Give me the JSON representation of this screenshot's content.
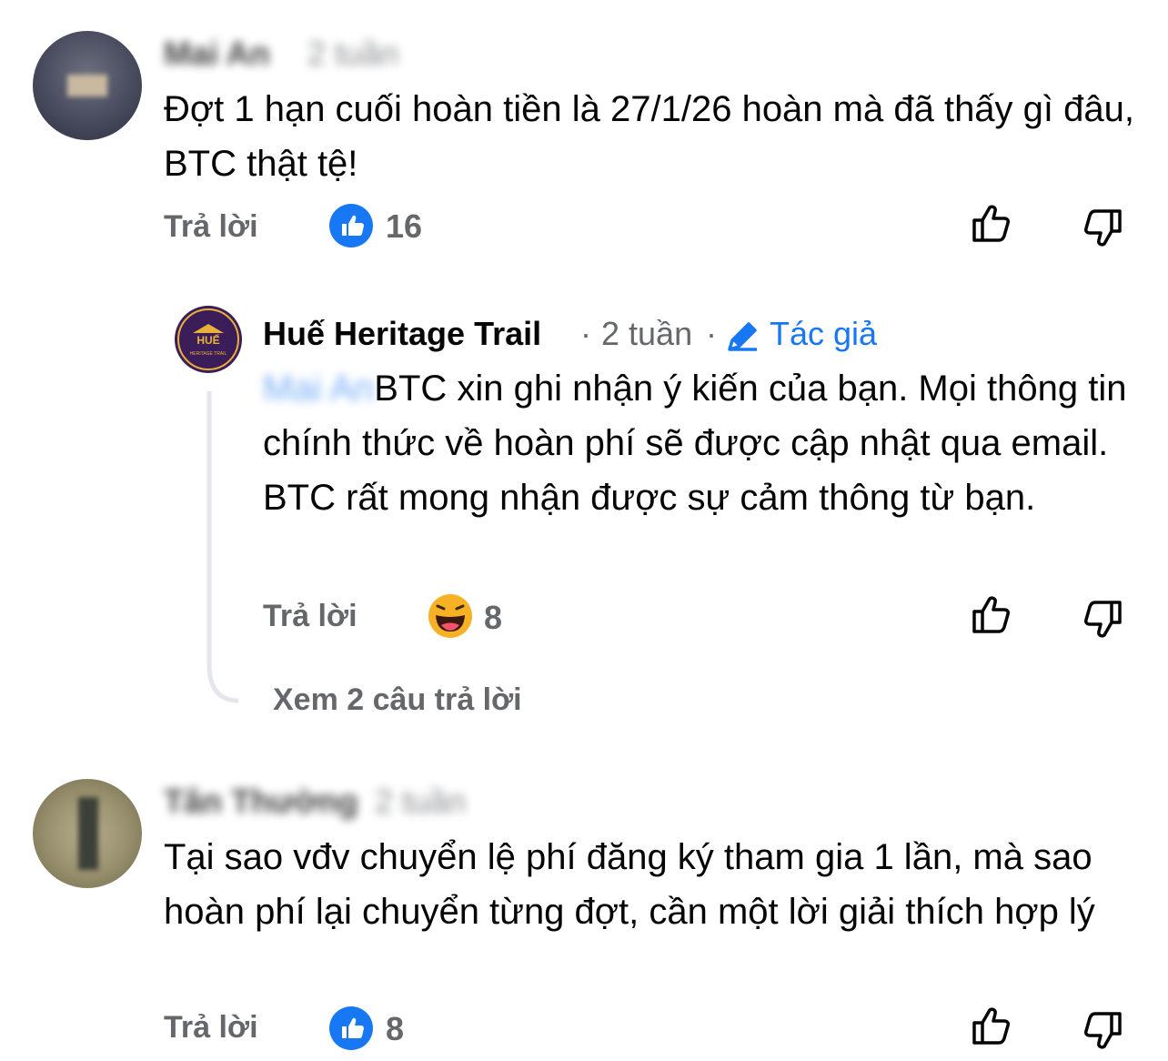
{
  "comments": [
    {
      "author": "Mai An",
      "time": "2 tuần",
      "text": "Đợt 1 hạn cuối hoàn tiền là 27/1/26 hoàn mà đã thấy gì đâu, BTC thật tệ!",
      "reply_label": "Trả lời",
      "reaction_count": "16",
      "reaction_type": "like-reaction-icon"
    },
    {
      "author": "Tân Thường",
      "time": "2 tuần",
      "text": "Tại sao vđv chuyển lệ phí đăng ký tham gia 1 lần, mà sao hoàn phí lại chuyển từng đợt, cần một lời giải thích hợp lý",
      "reply_label": "Trả lời",
      "reaction_count": "8",
      "reaction_type": "like-reaction-icon"
    }
  ],
  "reply": {
    "author": "Huế Heritage Trail",
    "separator": "·",
    "time": "2 tuần",
    "author_badge": "Tác giả",
    "mention": "Mai An",
    "text": "BTC xin ghi nhận ý kiến của bạn. Mọi thông tin chính thức về hoàn phí sẽ được cập nhật qua email. BTC rất mong nhận được sự cảm thông từ bạn.",
    "reply_label": "Trả lời",
    "reaction_count": "8",
    "reaction_type": "haha-reaction-icon",
    "avatar_logo_text": "HUẾ",
    "avatar_logo_subtext": "HERITAGE TRAIL"
  },
  "view_more_replies": "Xem 2 câu trả lời",
  "colors": {
    "like_blue": "#1877f2",
    "secondary_text": "#65676b",
    "mention_blue": "#1877f2",
    "haha_yellow": "#f7b125",
    "brand_purple": "#3b1d5a"
  }
}
